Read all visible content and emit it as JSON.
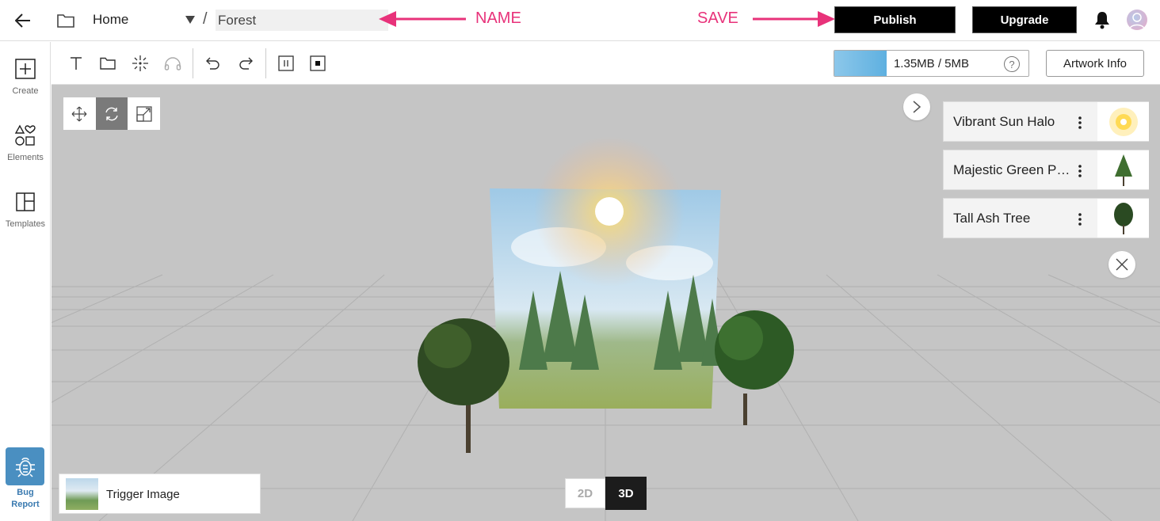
{
  "topbar": {
    "home_label": "Home",
    "separator": "/",
    "artwork_name": "Forest",
    "annotation_name": "NAME",
    "annotation_save": "SAVE",
    "publish_label": "Publish",
    "upgrade_label": "Upgrade"
  },
  "sidebar": {
    "items": [
      {
        "label": "Create",
        "icon": "plus-square-icon"
      },
      {
        "label": "Elements",
        "icon": "shapes-icon"
      },
      {
        "label": "Templates",
        "icon": "layout-icon"
      }
    ],
    "bug_line1": "Bug",
    "bug_line2": "Report"
  },
  "toolbar": {
    "tools": [
      "text-icon",
      "folder-icon",
      "sparkle-icon",
      "headphones-icon",
      "undo-icon",
      "redo-icon",
      "pause-icon",
      "stop-icon"
    ],
    "storage_text": "1.35MB / 5MB",
    "storage_used_fraction": 0.27,
    "help_glyph": "?",
    "artwork_info_label": "Artwork Info"
  },
  "transform_tools": [
    {
      "name": "move-icon",
      "active": false
    },
    {
      "name": "rotate-icon",
      "active": true
    },
    {
      "name": "scale-icon",
      "active": false
    }
  ],
  "layers": [
    {
      "name": "Vibrant Sun Halo",
      "thumb": "sun-thumb"
    },
    {
      "name": "Majestic Green Pine",
      "thumb": "tree-thumb"
    },
    {
      "name": "Tall Ash Tree",
      "thumb": "tree-thumb"
    }
  ],
  "trigger_label": "Trigger Image",
  "view_modes": {
    "off": "2D",
    "on": "3D"
  },
  "colors": {
    "accent_pink": "#e8327a",
    "bug_blue": "#4a8fc1",
    "canvas_gray": "#c5c5c5"
  }
}
